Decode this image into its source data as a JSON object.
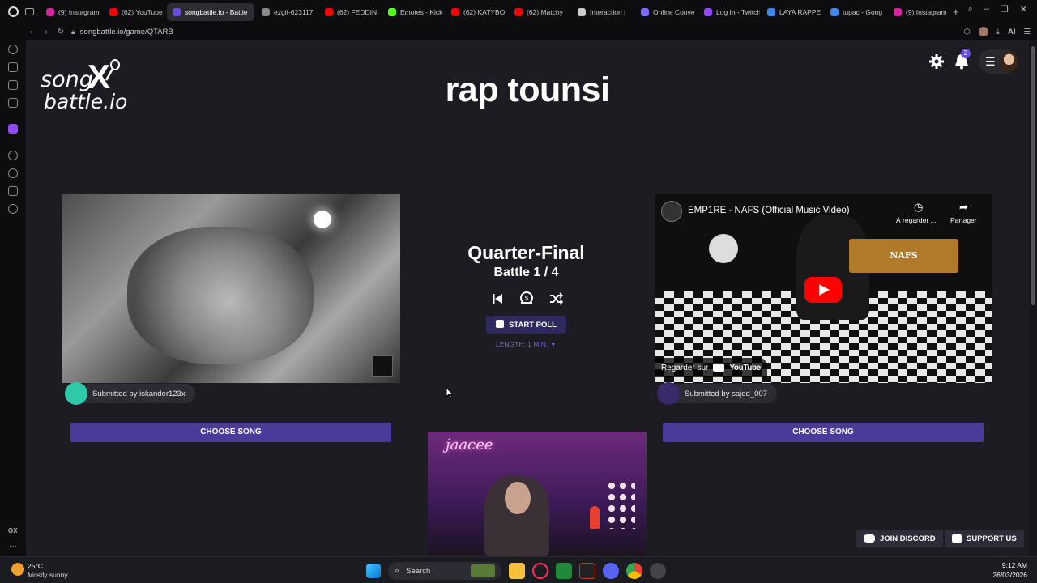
{
  "browser": {
    "tabs": [
      {
        "label": "(9) Instagram",
        "color": "#d6249f"
      },
      {
        "label": "(62) YouTube",
        "color": "#ff0000"
      },
      {
        "label": "songbattle.io - Battle",
        "color": "#6a4de0",
        "active": true
      },
      {
        "label": "ezgif-623117",
        "color": "#888888"
      },
      {
        "label": "(62) FEDDIN",
        "color": "#ff0000"
      },
      {
        "label": "Emotes - Kick",
        "color": "#53fc18"
      },
      {
        "label": "(62) KATYBO",
        "color": "#ff0000"
      },
      {
        "label": "(62) Matchy",
        "color": "#ff0000"
      },
      {
        "label": "Interaction |",
        "color": "#cccccc"
      },
      {
        "label": "Online Conve",
        "color": "#7a6cff"
      },
      {
        "label": "Log In - Twitch",
        "color": "#9146ff"
      },
      {
        "label": "LAYA RAPPE",
        "color": "#4285f4"
      },
      {
        "label": "tupac - Goog",
        "color": "#4285f4"
      },
      {
        "label": "(9) Instagram",
        "color": "#d6249f"
      }
    ],
    "url": "songbattle.io/game/QTARB",
    "ai_label": "AI"
  },
  "site": {
    "logo_line1": "song",
    "logo_line2": "battle.io",
    "title": "rap tounsi",
    "notification_count": "2"
  },
  "center": {
    "round": "Quarter-Final",
    "battle": "Battle 1 / 4",
    "start_poll": "START POLL",
    "length": "LENGTH: 1 MIN. ▼"
  },
  "left_song": {
    "submitted_by": "Submitted by iskander123x",
    "choose": "CHOOSE SONG",
    "avatar_color": "#2ec9a6"
  },
  "right_song": {
    "video_title": "EMP1RE - NAFS (Official Music Video)",
    "watch_later": "À regarder ...",
    "share": "Partager",
    "watch_on": "Regarder sur",
    "youtube": "YouTube",
    "nafs_logo": "NAFS",
    "submitted_by": "Submitted by sajed_007",
    "choose": "CHOOSE SONG",
    "avatar_color": "#3a2a6a"
  },
  "webcam": {
    "neon_text": "jaacee"
  },
  "footer_buttons": {
    "discord": "JOIN DISCORD",
    "support": "SUPPORT US"
  },
  "taskbar": {
    "weather_temp": "25°C",
    "weather_desc": "Mostly sunny",
    "search": "Search",
    "time": "9:12 AM",
    "date": "26/03/2026"
  },
  "sidebar_gx": "GX"
}
